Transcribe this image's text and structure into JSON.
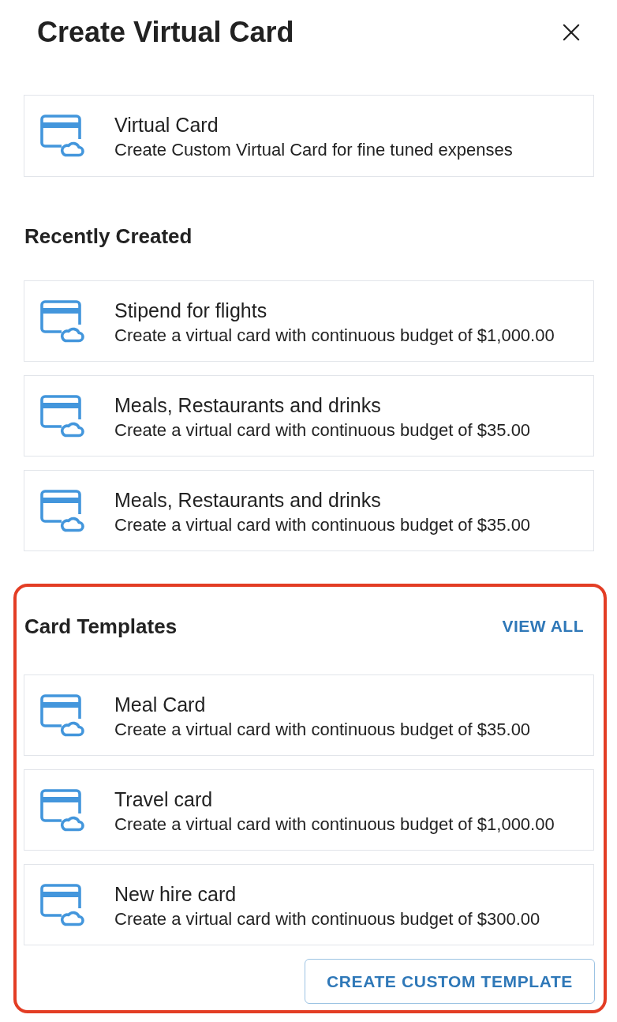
{
  "header": {
    "title": "Create Virtual Card"
  },
  "primary_option": {
    "title": "Virtual Card",
    "description": "Create Custom Virtual Card for fine tuned expenses"
  },
  "recently_created": {
    "heading": "Recently Created",
    "items": [
      {
        "title": "Stipend for flights",
        "description": "Create a virtual card with continuous budget of $1,000.00"
      },
      {
        "title": "Meals, Restaurants and drinks",
        "description": "Create a virtual card with continuous budget of $35.00"
      },
      {
        "title": "Meals, Restaurants and drinks",
        "description": "Create a virtual card with continuous budget of $35.00"
      }
    ]
  },
  "card_templates": {
    "heading": "Card Templates",
    "highlighted": true,
    "view_all": "VIEW ALL",
    "items": [
      {
        "title": "Meal Card",
        "description": "Create a virtual card with continuous budget of $35.00"
      },
      {
        "title": "Travel card",
        "description": "Create a virtual card with continuous budget of $1,000.00"
      },
      {
        "title": "New hire card",
        "description": "Create a virtual card with continuous budget of $300.00"
      }
    ],
    "create_button": "CREATE CUSTOM TEMPLATE"
  }
}
